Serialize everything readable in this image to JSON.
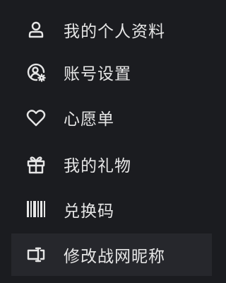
{
  "menu": {
    "items": [
      {
        "label": "我的个人资料",
        "icon": "user-icon"
      },
      {
        "label": "账号设置",
        "icon": "account-settings-icon"
      },
      {
        "label": "心愿单",
        "icon": "heart-icon"
      },
      {
        "label": "我的礼物",
        "icon": "gift-icon"
      },
      {
        "label": "兑换码",
        "icon": "barcode-icon"
      },
      {
        "label": "修改战网昵称",
        "icon": "rename-icon",
        "active": true
      }
    ]
  },
  "colors": {
    "background": "#1b1c20",
    "active_background": "#26272c",
    "text": "#e6e6e6"
  }
}
